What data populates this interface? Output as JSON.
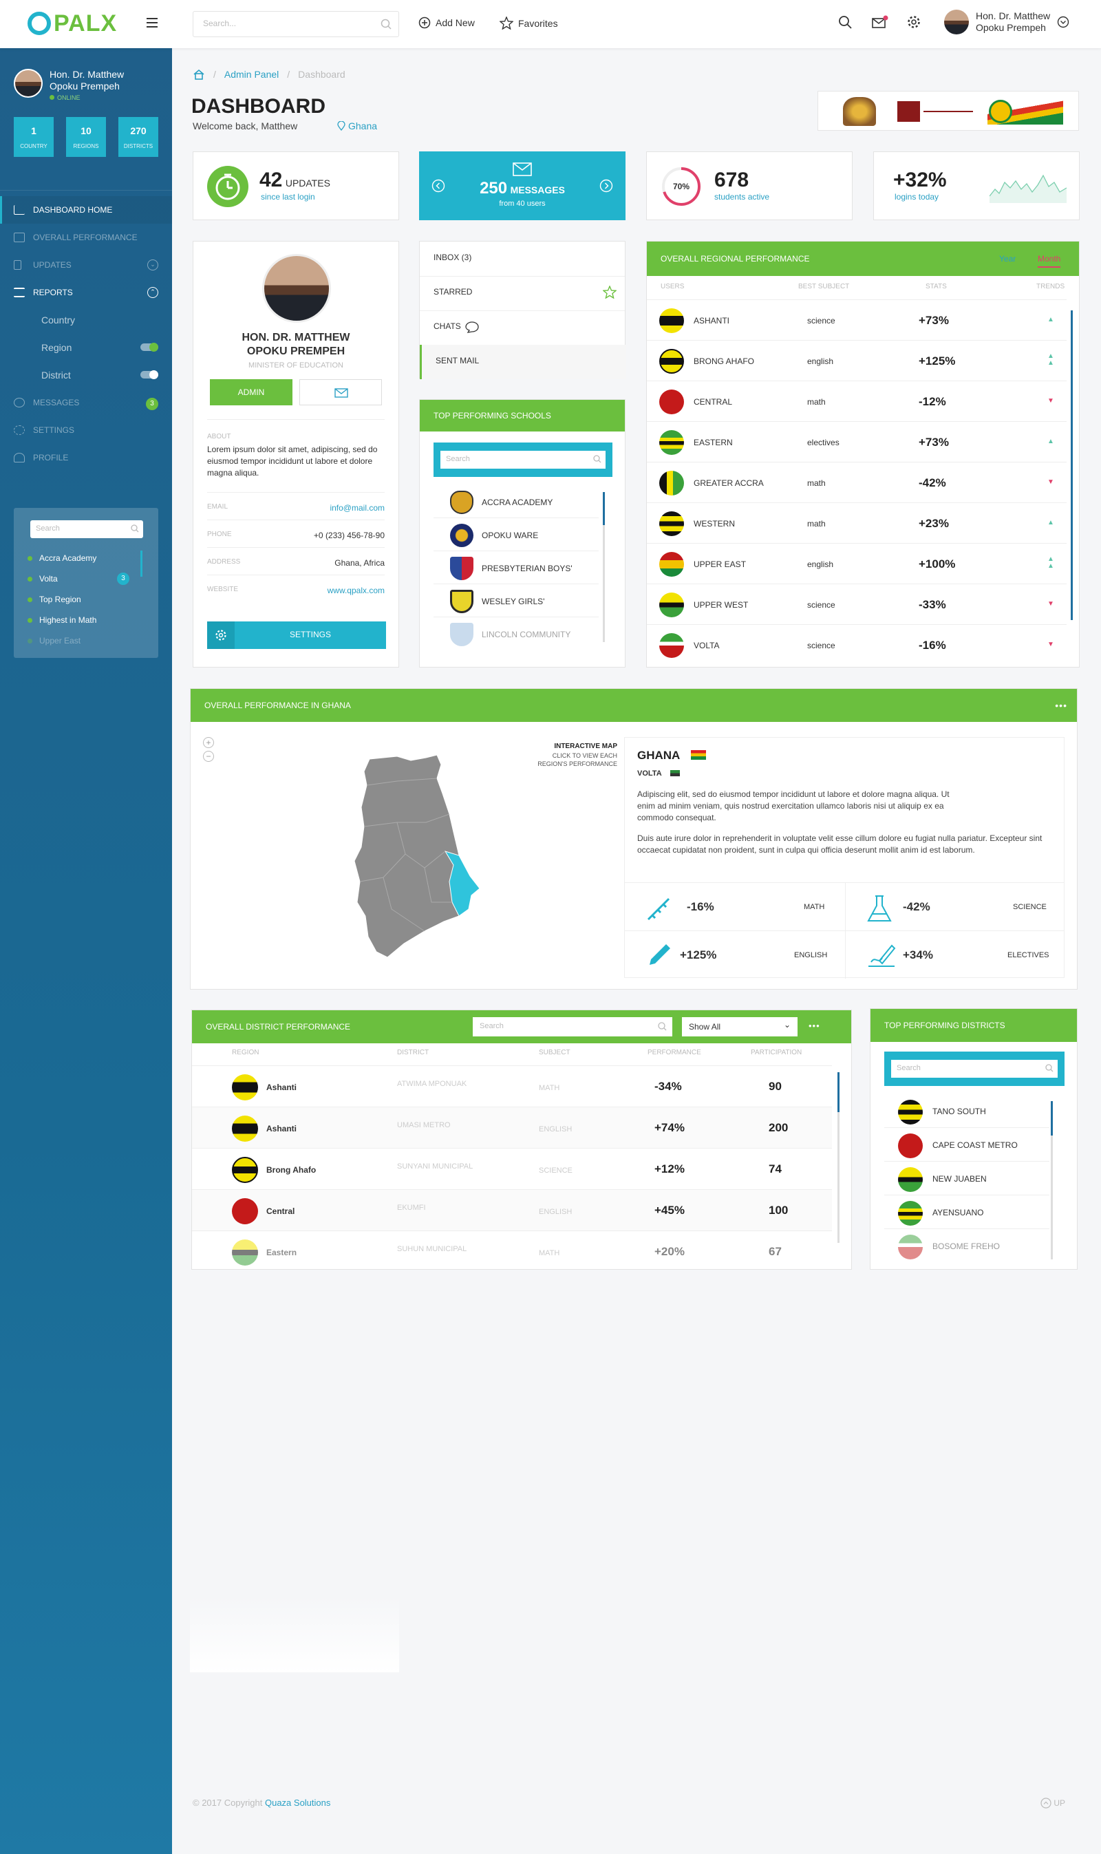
{
  "brand": {
    "logo_text": "PALX",
    "accent": "#6bbf3e",
    "cyan": "#22b3cc",
    "navy": "#1f5f8a"
  },
  "topbar": {
    "search_placeholder": "Search...",
    "add_new": "Add New",
    "favorites": "Favorites",
    "user_line1": "Hon. Dr. Matthew",
    "user_line2": "Opoku Prempeh"
  },
  "sidebar": {
    "user_line1": "Hon. Dr. Matthew",
    "user_line2": "Opoku Prempeh",
    "status": "ONLINE",
    "stats": [
      {
        "value": "1",
        "label": "COUNTRY"
      },
      {
        "value": "10",
        "label": "REGIONS"
      },
      {
        "value": "270",
        "label": "DISTRICTS"
      }
    ],
    "nav": {
      "home": "DASHBOARD HOME",
      "overall": "OVERALL PERFORMANCE",
      "updates": "UPDATES",
      "reports": "REPORTS",
      "country": "Country",
      "region": "Region",
      "district": "District",
      "messages": "MESSAGES",
      "messages_badge": "3",
      "settings": "SETTINGS",
      "profile": "PROFILE"
    },
    "filter": {
      "placeholder": "Search",
      "items": [
        "Accra Academy",
        "Volta",
        "Top Region",
        "Highest in Math",
        "Upper East"
      ],
      "volta_badge": "3"
    }
  },
  "breadcrumb": {
    "admin": "Admin Panel",
    "current": "Dashboard"
  },
  "page": {
    "title": "DASHBOARD",
    "welcome": "Welcome back, Matthew",
    "location": "Ghana"
  },
  "stats": {
    "updates": {
      "value": "42",
      "label": "UPDATES",
      "sub": "since last login"
    },
    "messages": {
      "value": "250",
      "label": "MESSAGES",
      "sub": "from 40 users"
    },
    "students": {
      "percent": "70%",
      "value": "678",
      "sub": "students active",
      "progress": 0.7
    },
    "logins": {
      "value": "+32%",
      "sub": "logins today"
    }
  },
  "profile": {
    "name1": "HON. DR. MATTHEW",
    "name2": "OPOKU PREMPEH",
    "role": "MINISTER OF EDUCATION",
    "admin_btn": "ADMIN",
    "about_label": "ABOUT",
    "about": "Lorem ipsum dolor sit amet, adipiscing, sed do eiusmod tempor incididunt ut labore et dolore magna aliqua.",
    "email_label": "EMAIL",
    "email": "info@mail.com",
    "phone_label": "PHONE",
    "phone": "+0 (233) 456-78-90",
    "address_label": "ADDRESS",
    "address": "Ghana, Africa",
    "website_label": "WEBSITE",
    "website": "www.qpalx.com",
    "settings_btn": "SETTINGS"
  },
  "mailbox": {
    "inbox": "INBOX (3)",
    "starred": "STARRED",
    "chats": "CHATS",
    "sent": "SENT MAIL"
  },
  "schools": {
    "title": "TOP PERFORMING SCHOOLS",
    "search": "Search",
    "items": [
      "ACCRA ACADEMY",
      "OPOKU WARE",
      "PRESBYTERIAN BOYS'",
      "WESLEY GIRLS'",
      "LINCOLN COMMUNITY"
    ]
  },
  "regional": {
    "title": "OVERALL REGIONAL PERFORMANCE",
    "tab_year": "Year",
    "tab_month": "Month",
    "cols": [
      "USERS",
      "BEST SUBJECT",
      "STATS",
      "TRENDS"
    ],
    "rows": [
      {
        "name": "ASHANTI",
        "subject": "science",
        "stat": "+73%"
      },
      {
        "name": "BRONG AHAFO",
        "subject": "english",
        "stat": "+125%"
      },
      {
        "name": "CENTRAL",
        "subject": "math",
        "stat": "-12%"
      },
      {
        "name": "EASTERN",
        "subject": "electives",
        "stat": "+73%"
      },
      {
        "name": "GREATER ACCRA",
        "subject": "math",
        "stat": "-42%"
      },
      {
        "name": "WESTERN",
        "subject": "math",
        "stat": "+23%"
      },
      {
        "name": "UPPER EAST",
        "subject": "english",
        "stat": "+100%"
      },
      {
        "name": "UPPER WEST",
        "subject": "science",
        "stat": "-33%"
      },
      {
        "name": "VOLTA",
        "subject": "science",
        "stat": "-16%"
      }
    ]
  },
  "map": {
    "title": "OVERALL PERFORMANCE IN GHANA",
    "map_title": "INTERACTIVE MAP",
    "map_sub1": "CLICK TO VIEW EACH",
    "map_sub2": "REGION'S PERFORMANCE",
    "zoom_in": "+",
    "zoom_out": "−",
    "country": "GHANA",
    "region": "VOLTA",
    "p1": "Adipiscing elit, sed do eiusmod tempor incididunt ut labore et dolore magna aliqua. Ut enim ad minim veniam, quis nostrud exercitation ullamco laboris nisi ut aliquip ex ea commodo consequat.",
    "p2": "Duis aute irure dolor in reprehenderit in voluptate velit esse cillum dolore eu fugiat nulla pariatur. Excepteur sint occaecat cupidatat non proident, sunt in culpa qui officia deserunt mollit anim id est laborum.",
    "subjects": [
      {
        "value": "-16%",
        "label": "MATH"
      },
      {
        "value": "-42%",
        "label": "SCIENCE"
      },
      {
        "value": "+125%",
        "label": "ENGLISH"
      },
      {
        "value": "+34%",
        "label": "ELECTIVES"
      }
    ]
  },
  "district": {
    "title": "OVERALL DISTRICT PERFORMANCE",
    "search": "Search",
    "filter": "Show All",
    "cols": [
      "REGION",
      "DISTRICT",
      "SUBJECT",
      "PERFORMANCE",
      "PARTICIPATION"
    ],
    "rows": [
      {
        "region": "Ashanti",
        "district": "ATWIMA MPONUAK",
        "subject": "MATH",
        "perf": "-34%",
        "part": "90"
      },
      {
        "region": "Ashanti",
        "district": "UMASI METRO",
        "subject": "ENGLISH",
        "perf": "+74%",
        "part": "200"
      },
      {
        "region": "Brong Ahafo",
        "district": "SUNYANI MUNICIPAL",
        "subject": "SCIENCE",
        "perf": "+12%",
        "part": "74"
      },
      {
        "region": "Central",
        "district": "EKUMFI",
        "subject": "ENGLISH",
        "perf": "+45%",
        "part": "100"
      },
      {
        "region": "Eastern",
        "district": "SUHUN MUNICIPAL",
        "subject": "MATH",
        "perf": "+20%",
        "part": "67"
      }
    ]
  },
  "top_districts": {
    "title": "TOP PERFORMING DISTRICTS",
    "search": "Search",
    "items": [
      "TANO SOUTH",
      "CAPE COAST METRO",
      "NEW JUABEN",
      "AYENSUANO",
      "BOSOME FREHO"
    ]
  },
  "footer": {
    "copyright": "© 2017 Copyright",
    "company": "Quaza Solutions",
    "up": "UP"
  }
}
